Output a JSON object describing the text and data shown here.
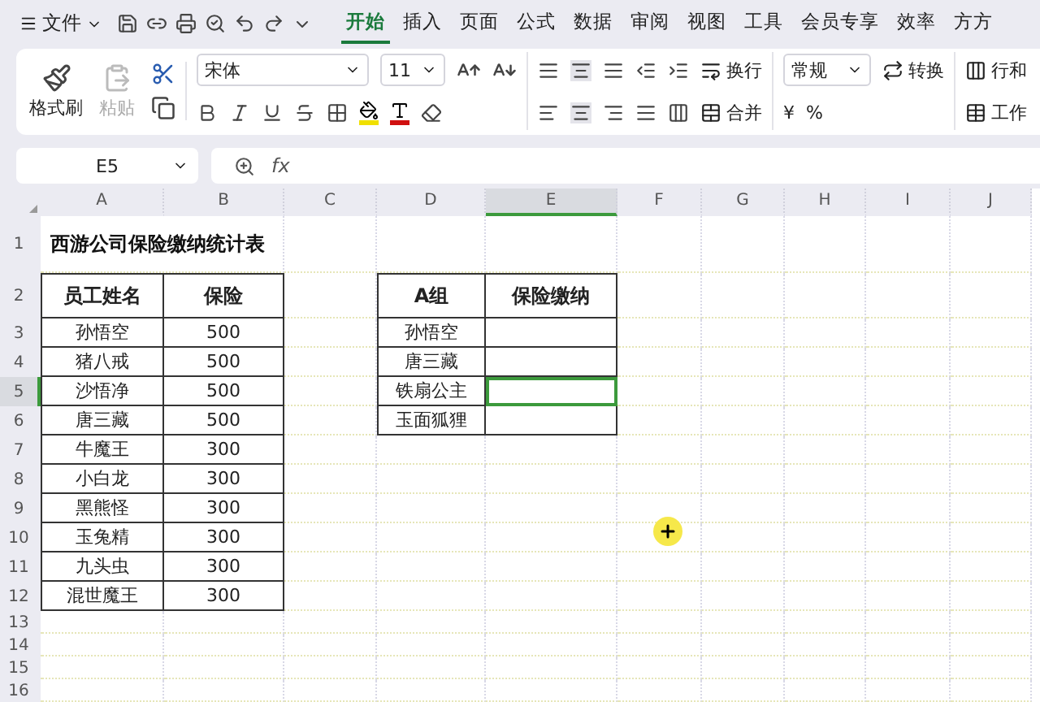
{
  "menu": {
    "file": "文件",
    "tabs": [
      {
        "label": "开始",
        "selected": true
      },
      {
        "label": "插入",
        "selected": false
      },
      {
        "label": "页面",
        "selected": false
      },
      {
        "label": "公式",
        "selected": false
      },
      {
        "label": "数据",
        "selected": false
      },
      {
        "label": "审阅",
        "selected": false
      },
      {
        "label": "视图",
        "selected": false
      },
      {
        "label": "工具",
        "selected": false
      },
      {
        "label": "会员专享",
        "selected": false
      },
      {
        "label": "效率",
        "selected": false
      },
      {
        "label": "方方",
        "selected": false
      }
    ]
  },
  "ribbon": {
    "format_painter": "格式刷",
    "paste": {
      "label": "粘贴",
      "disabled": true
    },
    "font_name": "宋体",
    "font_size": "11",
    "wrap": "换行",
    "merge": "合并",
    "number_format": "常规",
    "convert": "转换",
    "currency": "¥",
    "percent": "%",
    "row_col": "行和",
    "worksheet": "工作"
  },
  "formula_bar": {
    "name_box": "E5",
    "fx": "fx"
  },
  "columns": [
    {
      "label": "A",
      "selected": false
    },
    {
      "label": "B",
      "selected": false
    },
    {
      "label": "C",
      "selected": false
    },
    {
      "label": "D",
      "selected": false
    },
    {
      "label": "E",
      "selected": true
    },
    {
      "label": "F",
      "selected": false
    },
    {
      "label": "G",
      "selected": false
    },
    {
      "label": "H",
      "selected": false
    },
    {
      "label": "I",
      "selected": false
    },
    {
      "label": "J",
      "selected": false
    }
  ],
  "rows": [
    {
      "label": "1",
      "selected": false
    },
    {
      "label": "2",
      "selected": false
    },
    {
      "label": "3",
      "selected": false
    },
    {
      "label": "4",
      "selected": false
    },
    {
      "label": "5",
      "selected": true
    },
    {
      "label": "6",
      "selected": false
    },
    {
      "label": "7",
      "selected": false
    },
    {
      "label": "8",
      "selected": false
    },
    {
      "label": "9",
      "selected": false
    },
    {
      "label": "10",
      "selected": false
    },
    {
      "label": "11",
      "selected": false
    },
    {
      "label": "12",
      "selected": false
    },
    {
      "label": "13",
      "selected": false
    },
    {
      "label": "14",
      "selected": false
    },
    {
      "label": "15",
      "selected": false
    },
    {
      "label": "16",
      "selected": false
    }
  ],
  "title": "西游公司保险缴纳统计表",
  "table_1": {
    "headers": [
      "员工姓名",
      "保险"
    ],
    "rows": [
      [
        "孙悟空",
        "500"
      ],
      [
        "猪八戒",
        "500"
      ],
      [
        "沙悟净",
        "500"
      ],
      [
        "唐三藏",
        "500"
      ],
      [
        "牛魔王",
        "300"
      ],
      [
        "小白龙",
        "300"
      ],
      [
        "黑熊怪",
        "300"
      ],
      [
        "玉兔精",
        "300"
      ],
      [
        "九头虫",
        "300"
      ],
      [
        "混世魔王",
        "300"
      ]
    ]
  },
  "table_2": {
    "headers": [
      "A组",
      "保险缴纳"
    ],
    "rows": [
      {
        "name": "孙悟空",
        "active": false
      },
      {
        "name": "唐三藏",
        "active": false
      },
      {
        "name": "铁扇公主",
        "active": true
      },
      {
        "name": "玉面狐狸",
        "active": false
      }
    ]
  }
}
